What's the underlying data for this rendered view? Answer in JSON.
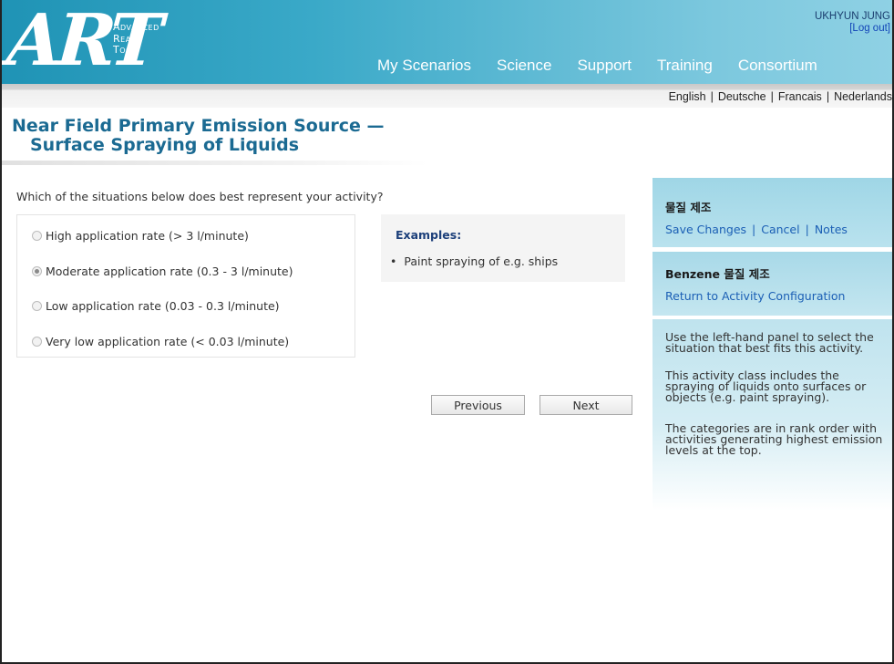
{
  "header": {
    "logo_letters": "ART",
    "logo_tag": [
      "Advanced",
      "Reach",
      "Tool"
    ],
    "user_name": "UKHYUN JUNG",
    "logout_label": "[Log out]",
    "nav": [
      "My Scenarios",
      "Science",
      "Support",
      "Training",
      "Consortium"
    ]
  },
  "languages": [
    "English",
    "Deutsche",
    "Francais",
    "Nederlands"
  ],
  "page": {
    "title_line1": "Near Field Primary Emission Source  —",
    "title_line2": "Surface Spraying of Liquids",
    "question": "Which of the situations below does best represent your activity?"
  },
  "options": [
    {
      "label": "High application rate (> 3 l/minute)",
      "checked": false
    },
    {
      "label": "Moderate application rate (0.3 - 3 l/minute)",
      "checked": true
    },
    {
      "label": "Low application rate (0.03 - 0.3 l/minute)",
      "checked": false
    },
    {
      "label": "Very low application rate (< 0.03 l/minute)",
      "checked": false
    }
  ],
  "examples": {
    "heading": "Examples:",
    "bullet": "•",
    "items": [
      "Paint spraying of e.g. ships"
    ]
  },
  "buttons": {
    "previous": "Previous",
    "next": "Next"
  },
  "sidebar": {
    "scenario_title": "물질 제조",
    "save_changes": "Save Changes",
    "cancel": "Cancel",
    "notes": "Notes",
    "substance_bold": "Benzene",
    "substance_rest": " 물질 제조",
    "return_link": "Return to Activity Configuration",
    "help": [
      "Use the left-hand panel to select the situation that best fits this activity.",
      "This activity class includes the spraying of liquids onto surfaces or objects (e.g. paint spraying).",
      "The categories are in rank order with activities generating highest emission levels at the top."
    ]
  }
}
